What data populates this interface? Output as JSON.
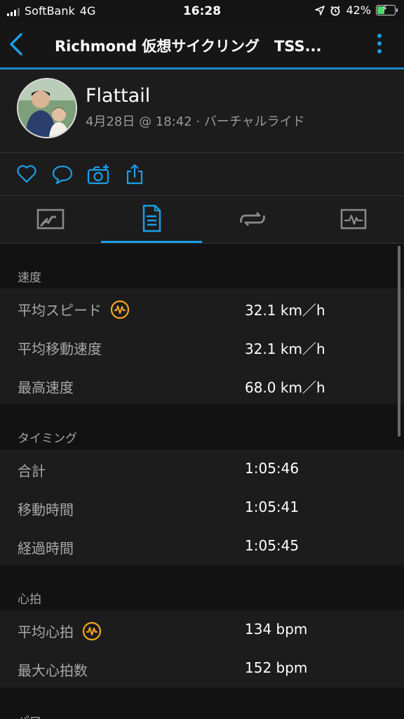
{
  "status_bar": {
    "carrier": "SoftBank",
    "network": "4G",
    "time": "16:28",
    "battery": "42%",
    "icons": [
      "signal-icon",
      "location-icon",
      "alarm-icon",
      "battery-charging-icon"
    ]
  },
  "app_bar": {
    "title": "Richmond 仮想サイクリング　TSS...",
    "back_icon": "chevron-left-icon",
    "menu_icon": "more-vertical-icon"
  },
  "profile": {
    "name": "Flattail",
    "meta": "4月28日 @ 18:42 · バーチャルライド"
  },
  "actions": [
    {
      "name": "like",
      "icon": "heart-icon"
    },
    {
      "name": "comment",
      "icon": "comment-icon"
    },
    {
      "name": "add-photo",
      "icon": "camera-plus-icon"
    },
    {
      "name": "share",
      "icon": "share-icon"
    }
  ],
  "tabs": [
    {
      "name": "overview",
      "icon": "map-chart-icon",
      "active": false
    },
    {
      "name": "stats",
      "icon": "stats-list-icon",
      "active": true
    },
    {
      "name": "laps",
      "icon": "laps-icon",
      "active": false
    },
    {
      "name": "charts",
      "icon": "chart-icon",
      "active": false
    }
  ],
  "sections": {
    "speed": {
      "title": "速度",
      "rows": [
        {
          "label": "平均スピード",
          "value": "32.1 km／h",
          "badge": "performance-icon"
        },
        {
          "label": "平均移動速度",
          "value": "32.1 km／h"
        },
        {
          "label": "最高速度",
          "value": "68.0 km／h"
        }
      ]
    },
    "timing": {
      "title": "タイミング",
      "rows": [
        {
          "label": "合計",
          "value": "1:05:46"
        },
        {
          "label": "移動時間",
          "value": "1:05:41"
        },
        {
          "label": "経過時間",
          "value": "1:05:45"
        }
      ]
    },
    "heart": {
      "title": "心拍",
      "rows": [
        {
          "label": "平均心拍",
          "value": "134 bpm",
          "badge": "performance-icon"
        },
        {
          "label": "最大心拍数",
          "value": "152 bpm"
        }
      ]
    },
    "next": {
      "title": "パワー"
    }
  },
  "colors": {
    "accent": "#1b9ee6",
    "badge": "#f5a623",
    "background": "#121212",
    "panel": "#1c1c1c"
  }
}
